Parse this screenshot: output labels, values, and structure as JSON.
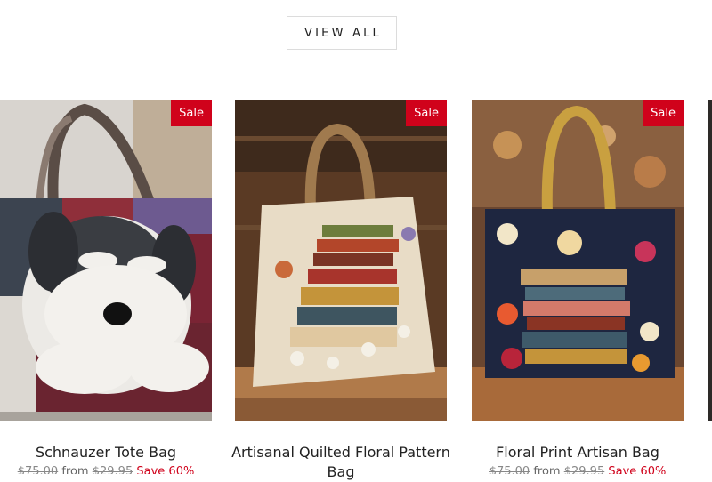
{
  "header": {
    "view_all_label": "VIEW ALL"
  },
  "sale_badge": "Sale",
  "colors": {
    "sale_badge": "#d0021b",
    "save_text": "#d0021b"
  },
  "products": [
    {
      "title": "Schnauzer Tote Bag",
      "compare_price": "$75.00",
      "price": "$29.95",
      "price_prefix": "from",
      "save": "Save 60%",
      "image": "schnauzer-tote-bag-image"
    },
    {
      "title": "Artisanal Quilted Floral Pattern Bag",
      "compare_price": "",
      "price": "",
      "price_prefix": "",
      "save": "",
      "image": "quilted-floral-book-bag-image"
    },
    {
      "title": "Floral Print Artisan Bag",
      "compare_price": "$75.00",
      "price": "$29.95",
      "price_prefix": "from",
      "save": "Save 60%",
      "image": "floral-book-bag-image"
    }
  ]
}
